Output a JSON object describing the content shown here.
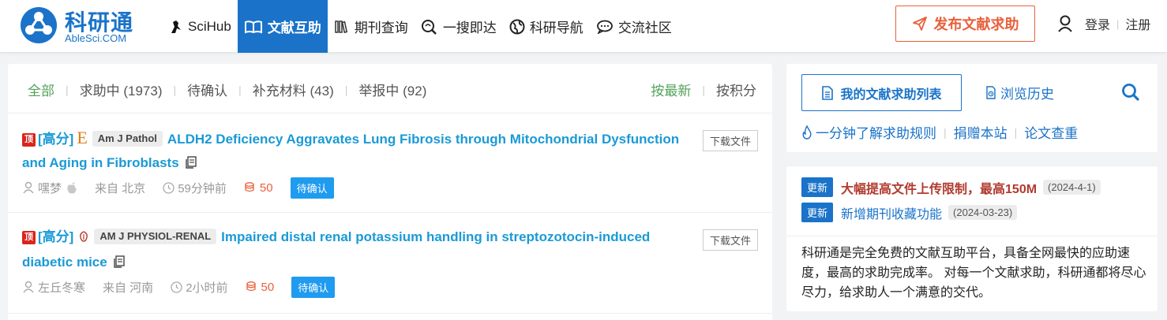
{
  "brand": {
    "title": "科研通",
    "subtitle": "AbleSci.COM",
    "color": "#1a73c9"
  },
  "nav": [
    {
      "label": "SciHub",
      "icon": "crow-icon"
    },
    {
      "label": "文献互助",
      "icon": "book-icon",
      "active": true
    },
    {
      "label": "期刊查询",
      "icon": "library-icon"
    },
    {
      "label": "一搜即达",
      "icon": "search-refresh-icon"
    },
    {
      "label": "科研导航",
      "icon": "globe-icon"
    },
    {
      "label": "交流社区",
      "icon": "chat-icon"
    }
  ],
  "header": {
    "publish_label": "发布文献求助",
    "login_label": "登录",
    "register_label": "注册"
  },
  "filters": {
    "tabs": [
      "全部",
      "求助中 (1973)",
      "待确认",
      "补充材料 (43)",
      "举报中 (92)"
    ],
    "sort": [
      "按最新",
      "按积分"
    ]
  },
  "items": [
    {
      "top_badge": "顶",
      "level": "[高分]",
      "journal": "Am J Pathol",
      "title": "ALDH2 Deficiency Aggravates Lung Fibrosis through Mitochondrial Dysfunction and Aging in Fibroblasts",
      "download_label": "下载文件",
      "user": "嘿梦",
      "location": "来自 北京",
      "time": "59分钟前",
      "points": "50",
      "status": "待确认"
    },
    {
      "top_badge": "顶",
      "level": "[高分]",
      "journal": "AM J PHYSIOL-RENAL",
      "title": "Impaired distal renal potassium handling in streptozotocin-induced diabetic mice",
      "download_label": "下载文件",
      "user": "左丘冬寒",
      "location": "来自 河南",
      "time": "2小时前",
      "points": "50",
      "status": "待确认"
    }
  ],
  "sidebar": {
    "my_list_label": "我的文献求助列表",
    "history_label": "浏览历史",
    "links": [
      "一分钟了解求助规则",
      "捐赠本站",
      "论文查重"
    ],
    "news": [
      {
        "badge": "更新",
        "text": "大幅提高文件上传限制，最高150M",
        "date": "(2024-4-1)"
      },
      {
        "badge": "更新",
        "text": "新增期刊收藏功能",
        "date": "(2024-03-23)"
      }
    ],
    "intro": "科研通是完全免费的文献互助平台，具备全网最快的应助速度，最高的求助完成率。 对每一个文献求助，科研通都将尽心尽力，给求助人一个满意的交代。"
  }
}
